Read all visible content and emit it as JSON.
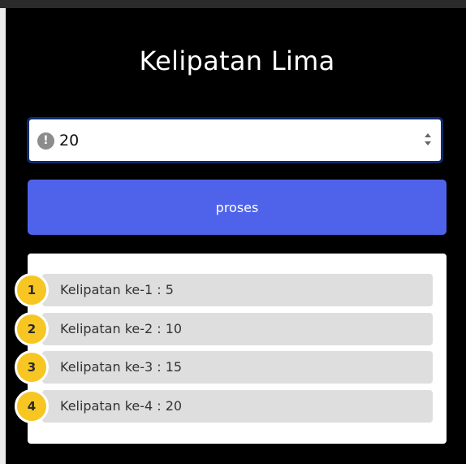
{
  "page": {
    "title": "Kelipatan Lima"
  },
  "input": {
    "value": "20",
    "warning_icon": "exclamation-circle-icon"
  },
  "button": {
    "label": "proses"
  },
  "results": [
    {
      "number": "1",
      "label": "Kelipatan ke-1 : 5"
    },
    {
      "number": "2",
      "label": "Kelipatan ke-2 : 10"
    },
    {
      "number": "3",
      "label": "Kelipatan ke-3 : 15"
    },
    {
      "number": "4",
      "label": "Kelipatan ke-4 : 20"
    }
  ],
  "colors": {
    "background": "#000000",
    "button": "#4f63ea",
    "badge": "#f8c623",
    "item": "#dedede"
  }
}
